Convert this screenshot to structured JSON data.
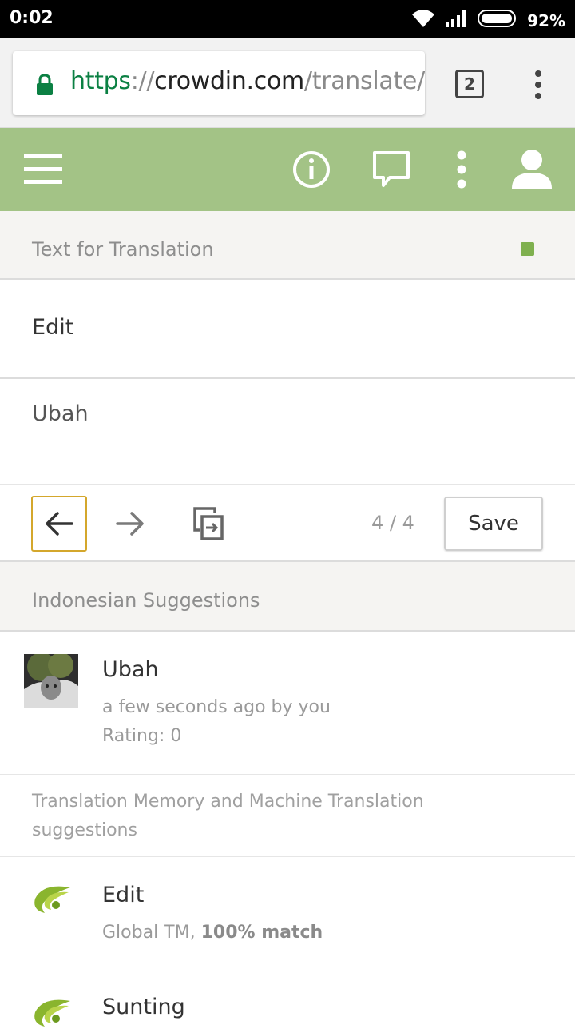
{
  "status_bar": {
    "time": "0:02",
    "battery": "92%"
  },
  "browser": {
    "url_scheme": "https",
    "url_sep": "://",
    "url_host": "crowdin.com",
    "url_path": "/translate/",
    "tab_count": "2"
  },
  "colors": {
    "appbar": "#a3c386",
    "status_dot": "#7fb04f",
    "url_green": "#0b8043",
    "prev_border": "#d4a72c"
  },
  "appbar": {
    "icons": [
      "menu-icon",
      "info-icon",
      "comment-icon",
      "more-vert-icon",
      "user-icon"
    ]
  },
  "source": {
    "header": "Text for Translation",
    "text": "Edit"
  },
  "translation": {
    "text": "Ubah"
  },
  "toolbar": {
    "counter": "4 / 4",
    "save_label": "Save"
  },
  "suggestions": {
    "header": "Indonesian Suggestions",
    "items": [
      {
        "text": "Ubah",
        "time": "a few seconds ago by you",
        "rating": "Rating: 0"
      }
    ]
  },
  "tm": {
    "header": "Translation Memory and Machine Translation suggestions",
    "items": [
      {
        "text": "Edit",
        "source": "Global TM",
        "separator": ", ",
        "match": "100% match"
      },
      {
        "text": "Sunting"
      }
    ]
  }
}
